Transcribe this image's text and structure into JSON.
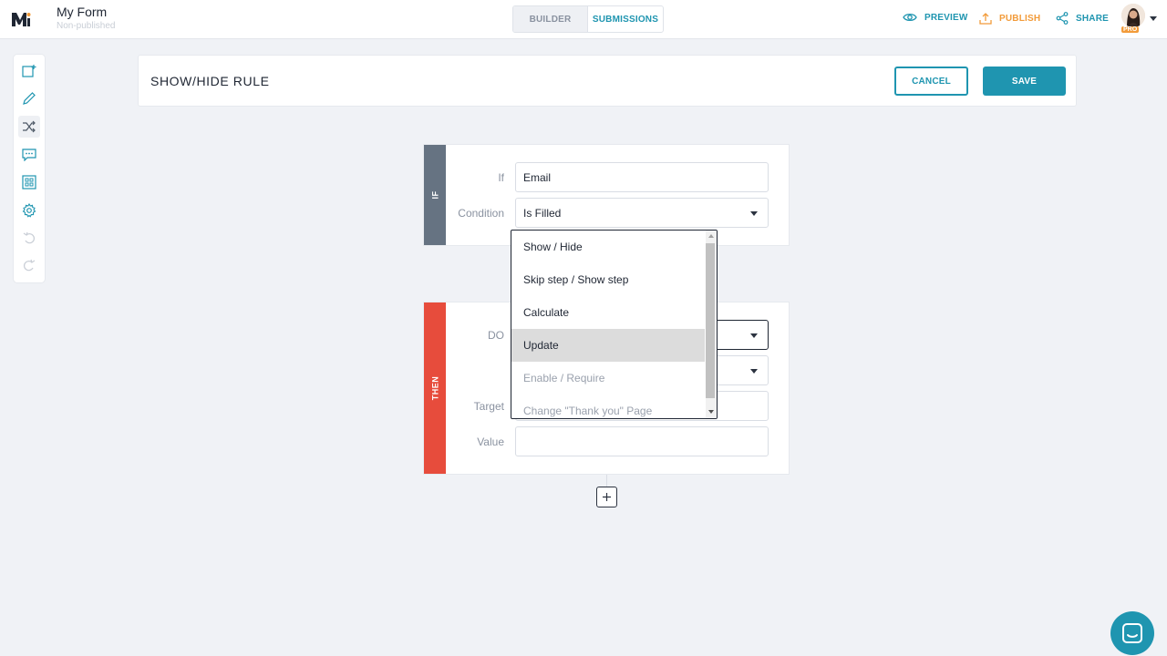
{
  "app": {
    "form_title": "My Form",
    "form_status": "Non-published",
    "logo_icon": "forminator-logo",
    "accent_color": "#1f95b0",
    "publish_color": "#f29b3a"
  },
  "nav": {
    "builder_label": "BUILDER",
    "submissions_label": "SUBMISSIONS",
    "preview_label": "PREVIEW",
    "publish_label": "PUBLISH",
    "share_label": "SHARE",
    "pro_badge": "PRO"
  },
  "toolbar": {
    "items": [
      {
        "icon": "add-field-icon"
      },
      {
        "icon": "pencil-icon"
      },
      {
        "icon": "shuffle-icon",
        "active": true
      },
      {
        "icon": "message-icon"
      },
      {
        "icon": "layout-icon"
      },
      {
        "icon": "gear-icon"
      },
      {
        "icon": "undo-icon"
      },
      {
        "icon": "redo-icon"
      }
    ]
  },
  "header": {
    "title": "SHOW/HIDE RULE",
    "cancel_label": "CANCEL",
    "save_label": "SAVE"
  },
  "if_block": {
    "band_label": "IF",
    "if_label": "If",
    "if_value": "Email",
    "condition_label": "Condition",
    "condition_value": "Is Filled"
  },
  "then_block": {
    "band_label": "THEN",
    "do_label": "DO",
    "target_label": "Target",
    "value_label": "Value",
    "value_value": ""
  },
  "dropdown": {
    "options": [
      {
        "label": "Show / Hide"
      },
      {
        "label": "Skip step / Show step"
      },
      {
        "label": "Calculate"
      },
      {
        "label": "Update",
        "highlighted": true
      },
      {
        "label": "Enable / Require",
        "disabled": true
      },
      {
        "label": "Change \"Thank you\" Page",
        "disabled": true
      }
    ]
  }
}
